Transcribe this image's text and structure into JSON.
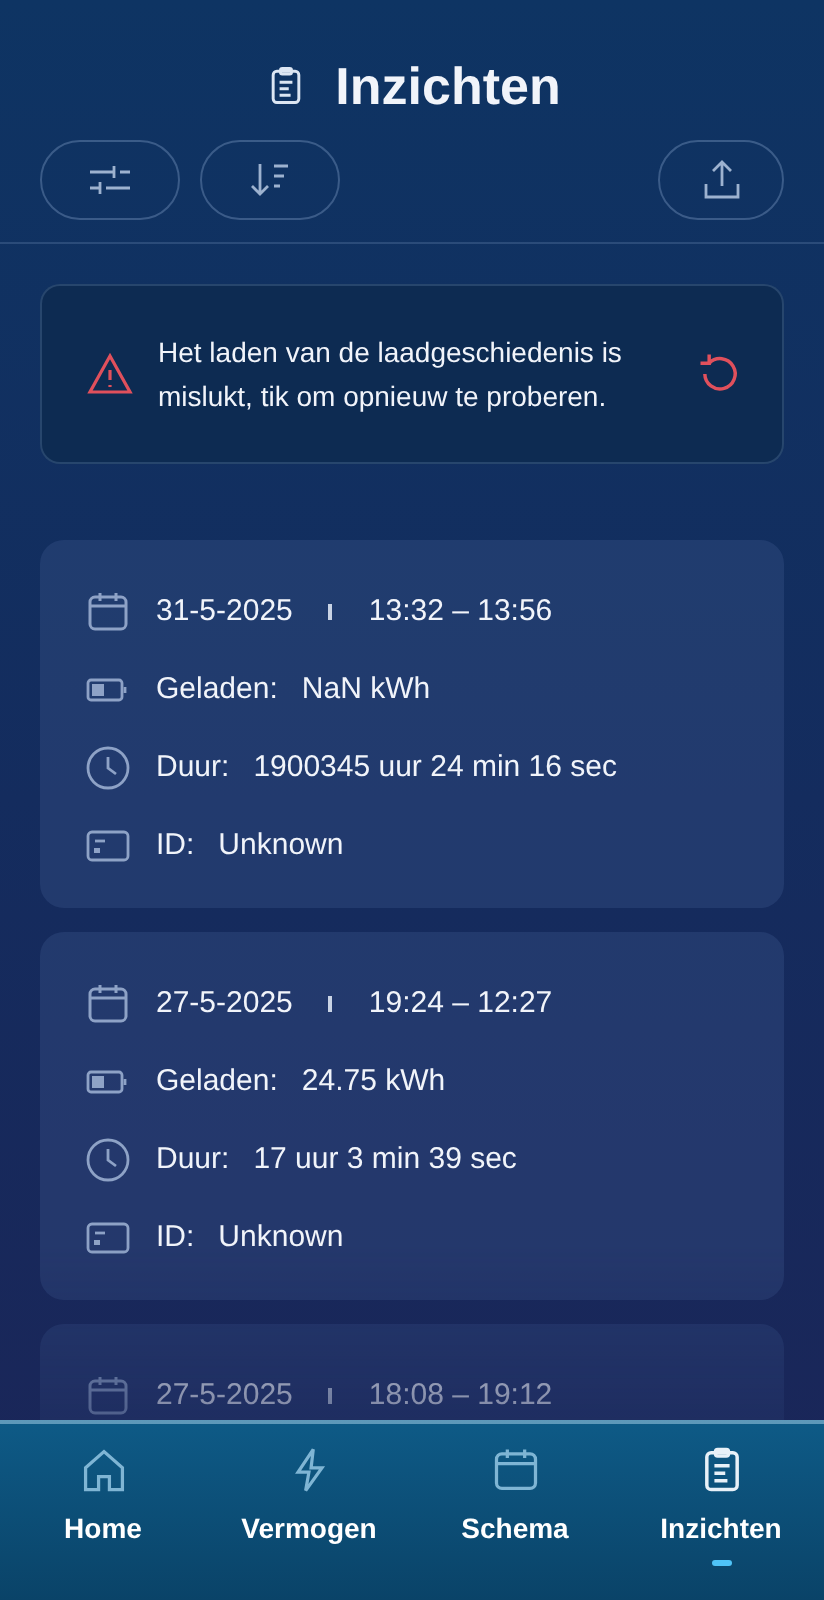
{
  "header": {
    "title": "Inzichten"
  },
  "toolbar": {
    "buttons": [
      {
        "kind": "filter"
      },
      {
        "kind": "sort"
      },
      {
        "kind": "export"
      }
    ]
  },
  "error": {
    "message": "Het laden van de laadgeschiedenis is mislukt, tik om opnieuw te proberen."
  },
  "sessions": [
    {
      "date": "31-5-2025",
      "time": "13:32 – 13:56",
      "charged_label": "Geladen:",
      "charged": "NaN kWh",
      "duration_label": "Duur:",
      "duration": "1900345 uur 24 min 16 sec",
      "id_label": "ID:",
      "id": "Unknown"
    },
    {
      "date": "27-5-2025",
      "time": "19:24 – 12:27",
      "charged_label": "Geladen:",
      "charged": "24.75 kWh",
      "duration_label": "Duur:",
      "duration": "17 uur 3 min 39 sec",
      "id_label": "ID:",
      "id": "Unknown"
    },
    {
      "date": "27-5-2025",
      "time": "18:08 – 19:12"
    }
  ],
  "nav": [
    {
      "label": "Home",
      "kind": "home",
      "selected": false
    },
    {
      "label": "Vermogen",
      "kind": "power",
      "selected": false
    },
    {
      "label": "Schema",
      "kind": "calendar",
      "selected": false
    },
    {
      "label": "Inzichten",
      "kind": "clipboard",
      "selected": true
    }
  ]
}
